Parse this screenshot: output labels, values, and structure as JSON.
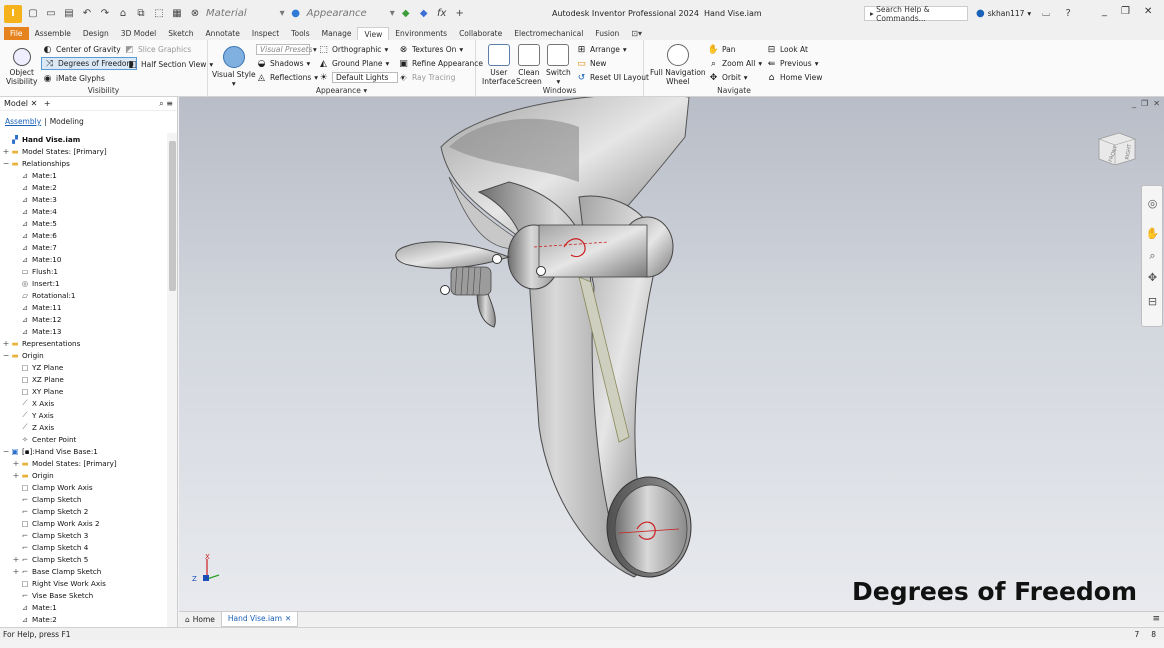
{
  "window": {
    "title": "Autodesk Inventor Professional 2024",
    "document": "Hand Vise.iam",
    "search_placeholder": "Search Help & Commands...",
    "user": "skhan117"
  },
  "qat": {
    "material_label": "Material",
    "appearance_label": "Appearance"
  },
  "tabs": [
    "File",
    "Assemble",
    "Design",
    "3D Model",
    "Sketch",
    "Annotate",
    "Inspect",
    "Tools",
    "Manage",
    "View",
    "Environments",
    "Collaborate",
    "Electromechanical",
    "Fusion"
  ],
  "active_tab": "View",
  "ribbon": {
    "visibility": {
      "title": "Visibility",
      "object_visibility": "Object\nVisibility",
      "center_of_gravity": "Center of Gravity",
      "slice_graphics": "Slice Graphics",
      "degrees_of_freedom": "Degrees of Freedom",
      "half_section_view": "Half Section View",
      "imate_glyphs": "iMate Glyphs"
    },
    "appearance": {
      "title": "Appearance",
      "visual_style": "Visual Style",
      "visual_presets": "Visual Presets",
      "orthographic": "Orthographic",
      "textures_on": "Textures On",
      "shadows": "Shadows",
      "ground_plane": "Ground Plane",
      "refine_appearance": "Refine Appearance",
      "reflections": "Reflections",
      "default_lights": "Default Lights",
      "ray_tracing": "Ray Tracing"
    },
    "windows": {
      "title": "Windows",
      "user_interface": "User\nInterface",
      "clean_screen": "Clean\nScreen",
      "switch": "Switch",
      "arrange": "Arrange",
      "new": "New",
      "reset_ui_layout": "Reset UI Layout"
    },
    "navigate": {
      "title": "Navigate",
      "full_nav_wheel": "Full Navigation\nWheel",
      "pan": "Pan",
      "zoom_all": "Zoom All",
      "orbit": "Orbit",
      "look_at": "Look At",
      "previous": "Previous",
      "home_view": "Home View"
    }
  },
  "browser": {
    "title": "Model",
    "mode_assembly": "Assembly",
    "mode_modeling": "Modeling",
    "items": [
      {
        "label": "Hand Vise.iam",
        "depth": 0,
        "bold": true,
        "icon": "assembly-icon",
        "toggle": ""
      },
      {
        "label": "Model States: [Primary]",
        "depth": 0,
        "icon": "folder-icon",
        "toggle": "+"
      },
      {
        "label": "Relationships",
        "depth": 0,
        "icon": "folder-icon",
        "toggle": "−"
      },
      {
        "label": "Mate:1",
        "depth": 1,
        "icon": "mate-icon",
        "toggle": ""
      },
      {
        "label": "Mate:2",
        "depth": 1,
        "icon": "mate-icon",
        "toggle": ""
      },
      {
        "label": "Mate:3",
        "depth": 1,
        "icon": "mate-icon",
        "toggle": ""
      },
      {
        "label": "Mate:4",
        "depth": 1,
        "icon": "mate-icon",
        "toggle": ""
      },
      {
        "label": "Mate:5",
        "depth": 1,
        "icon": "mate-icon",
        "toggle": ""
      },
      {
        "label": "Mate:6",
        "depth": 1,
        "icon": "mate-icon",
        "toggle": ""
      },
      {
        "label": "Mate:7",
        "depth": 1,
        "icon": "mate-icon",
        "toggle": ""
      },
      {
        "label": "Mate:10",
        "depth": 1,
        "icon": "mate-icon",
        "toggle": ""
      },
      {
        "label": "Flush:1",
        "depth": 1,
        "icon": "flush-icon",
        "toggle": ""
      },
      {
        "label": "Insert:1",
        "depth": 1,
        "icon": "insert-icon",
        "toggle": ""
      },
      {
        "label": "Rotational:1",
        "depth": 1,
        "icon": "rotational-icon",
        "toggle": ""
      },
      {
        "label": "Mate:11",
        "depth": 1,
        "icon": "mate-icon",
        "toggle": ""
      },
      {
        "label": "Mate:12",
        "depth": 1,
        "icon": "mate-icon",
        "toggle": ""
      },
      {
        "label": "Mate:13",
        "depth": 1,
        "icon": "mate-icon",
        "toggle": ""
      },
      {
        "label": "Representations",
        "depth": 0,
        "icon": "folder-icon",
        "toggle": "+"
      },
      {
        "label": "Origin",
        "depth": 0,
        "icon": "folder-icon",
        "toggle": "−"
      },
      {
        "label": "YZ Plane",
        "depth": 1,
        "icon": "plane-icon",
        "toggle": ""
      },
      {
        "label": "XZ Plane",
        "depth": 1,
        "icon": "plane-icon",
        "toggle": ""
      },
      {
        "label": "XY Plane",
        "depth": 1,
        "icon": "plane-icon",
        "toggle": ""
      },
      {
        "label": "X Axis",
        "depth": 1,
        "icon": "axis-icon",
        "toggle": ""
      },
      {
        "label": "Y Axis",
        "depth": 1,
        "icon": "axis-icon",
        "toggle": ""
      },
      {
        "label": "Z Axis",
        "depth": 1,
        "icon": "axis-icon",
        "toggle": ""
      },
      {
        "label": "Center Point",
        "depth": 1,
        "icon": "point-icon",
        "toggle": ""
      },
      {
        "label": "[▪]:Hand Vise Base:1",
        "depth": 0,
        "icon": "part-icon",
        "toggle": "−"
      },
      {
        "label": "Model States: [Primary]",
        "depth": 1,
        "icon": "folder-icon",
        "toggle": "+"
      },
      {
        "label": "Origin",
        "depth": 1,
        "icon": "folder-icon",
        "toggle": "+"
      },
      {
        "label": "Clamp Work Axis",
        "depth": 1,
        "icon": "plane-icon",
        "toggle": ""
      },
      {
        "label": "Clamp Sketch",
        "depth": 1,
        "icon": "sketch-icon",
        "toggle": ""
      },
      {
        "label": "Clamp Sketch 2",
        "depth": 1,
        "icon": "sketch-icon",
        "toggle": ""
      },
      {
        "label": "Clamp Work Axis 2",
        "depth": 1,
        "icon": "plane-icon",
        "toggle": ""
      },
      {
        "label": "Clamp Sketch 3",
        "depth": 1,
        "icon": "sketch-icon",
        "toggle": ""
      },
      {
        "label": "Clamp Sketch 4",
        "depth": 1,
        "icon": "sketch-icon",
        "toggle": ""
      },
      {
        "label": "Clamp Sketch 5",
        "depth": 1,
        "icon": "sketch-icon",
        "toggle": "+"
      },
      {
        "label": "Base Clamp Sketch",
        "depth": 1,
        "icon": "sketch-icon",
        "toggle": "+"
      },
      {
        "label": "Right Vise Work Axis",
        "depth": 1,
        "icon": "plane-icon",
        "toggle": ""
      },
      {
        "label": "Vise Base Sketch",
        "depth": 1,
        "icon": "sketch-icon",
        "toggle": ""
      },
      {
        "label": "Mate:1",
        "depth": 1,
        "icon": "mate-icon",
        "toggle": ""
      },
      {
        "label": "Mate:2",
        "depth": 1,
        "icon": "mate-icon",
        "toggle": ""
      }
    ]
  },
  "viewport": {
    "overlay_caption": "Degrees of Freedom",
    "viewcube_front": "FRONT",
    "viewcube_side": "RIGHT"
  },
  "doc_tabs": {
    "home": "Home",
    "active": "Hand Vise.iam"
  },
  "status": {
    "help": "For Help, press F1",
    "count_a": "7",
    "count_b": "8"
  },
  "colors": {
    "file_tab": "#e6831e",
    "accent": "#1a62b7",
    "dof_arrow": "#cc1f1f"
  }
}
